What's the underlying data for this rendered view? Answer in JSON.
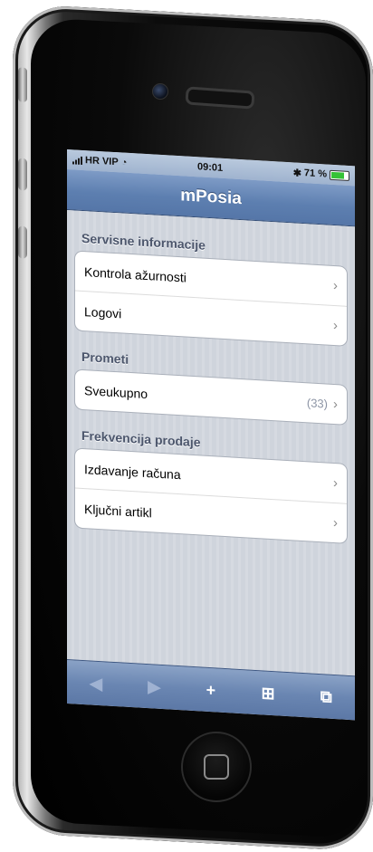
{
  "status_bar": {
    "carrier": "HR VIP",
    "time": "09:01",
    "battery": "71 %",
    "battery_level": 0.71
  },
  "nav": {
    "title": "mPosia"
  },
  "sections": [
    {
      "title": "Servisne informacije",
      "rows": [
        {
          "label": "Kontrola ažurnosti",
          "count": ""
        },
        {
          "label": "Logovi",
          "count": ""
        }
      ]
    },
    {
      "title": "Prometi",
      "rows": [
        {
          "label": "Sveukupno",
          "count": "(33)"
        }
      ]
    },
    {
      "title": "Frekvencija prodaje",
      "rows": [
        {
          "label": "Izdavanje računa",
          "count": ""
        },
        {
          "label": "Ključni artikl",
          "count": ""
        }
      ]
    }
  ],
  "toolbar": {
    "icons": [
      "back-icon",
      "forward-icon",
      "plus-icon",
      "bookmarks-icon",
      "pages-icon"
    ]
  },
  "colors": {
    "nav_bar": "#5d7fb0",
    "section_title": "#4c566c",
    "battery": "#36c236"
  }
}
